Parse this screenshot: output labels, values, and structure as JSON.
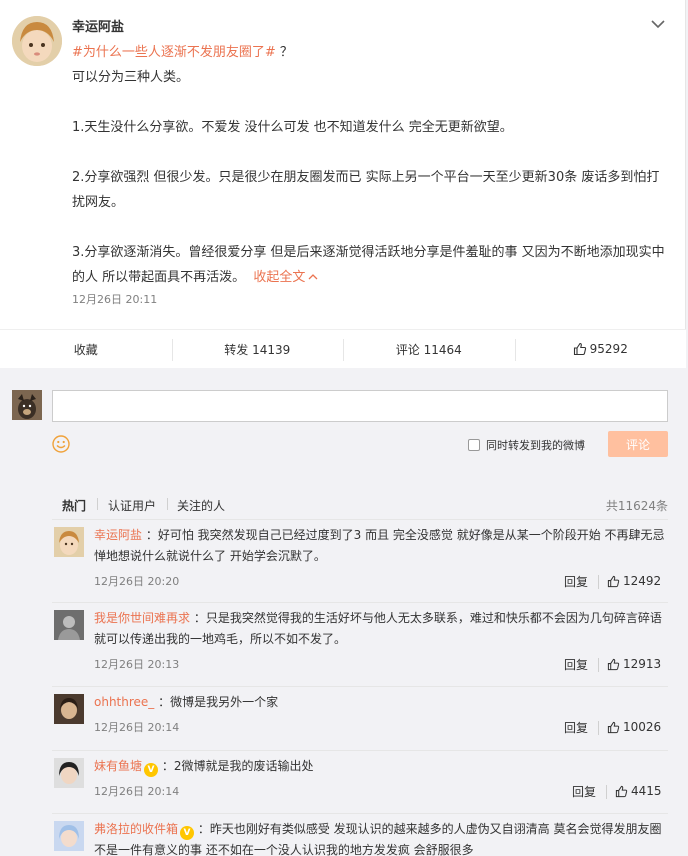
{
  "post": {
    "username": "幸运阿盐",
    "hashtag": "#为什么一些人逐渐不发朋友圈了#",
    "hashtag_suffix": " ？",
    "paragraphs": [
      "可以分为三种人类。",
      "1.天生没什么分享欲。不爱发 没什么可发 也不知道发什么 完全无更新欲望。",
      "2.分享欲强烈 但很少发。只是很少在朋友圈发而已 实际上另一个平台一天至少更新30条 废话多到怕打扰网友。",
      "3.分享欲逐渐消失。曾经很爱分享 但是后来逐渐觉得活跃地分享是件羞耻的事 又因为不断地添加现实中的人 所以带起面具不再活泼。"
    ],
    "collapse_link": "收起全文",
    "time": "12月26日 20:11"
  },
  "actions": {
    "favorite": "收藏",
    "repost": "转发 14139",
    "comment": "评论 11464",
    "likes": "95292"
  },
  "composer": {
    "placeholder": "",
    "sync_label": "同时转发到我的微博",
    "submit_label": "评论"
  },
  "comments_section": {
    "tabs": [
      "热门",
      "认证用户",
      "关注的人"
    ],
    "total": "共11624条",
    "reply_label": "回复",
    "comments": [
      {
        "username": "幸运阿盐",
        "verified": false,
        "text": "好可怕 我突然发现自己已经过度到了3 而且 完全没感觉 就好像是从某一个阶段开始 不再肆无忌惮地想说什么就说什么了 开始学会沉默了。",
        "time": "12月26日 20:20",
        "likes": "12492"
      },
      {
        "username": "我是你世间难再求",
        "verified": false,
        "text": "只是我突然觉得我的生活好坏与他人无太多联系，难过和快乐都不会因为几句碎言碎语就可以传递出我的一地鸡毛，所以不如不发了。",
        "time": "12月26日 20:13",
        "likes": "12913"
      },
      {
        "username": "ohhthree_",
        "verified": false,
        "text": "微博是我另外一个家",
        "time": "12月26日 20:14",
        "likes": "10026"
      },
      {
        "username": "妹有鱼塘",
        "verified": true,
        "text": "2微博就是我的废话输出处",
        "time": "12月26日 20:14",
        "likes": "4415"
      },
      {
        "username": "弗洛拉的收件箱",
        "verified": true,
        "text": "昨天也刚好有类似感受 发现认识的越来越多的人虚伪又自诩清高 莫名会觉得发朋友圈不是一件有意义的事 还不如在一个没人认识我的地方发发疯 会舒服很多",
        "time": "",
        "likes": ""
      }
    ]
  },
  "colors": {
    "accent": "#eb7350",
    "submit_disabled": "#ffc09f",
    "background": "#f2f2f5"
  },
  "icons": [
    "chevron-down-icon",
    "thumbs-up-icon",
    "smiley-icon",
    "verified-badge-icon"
  ]
}
